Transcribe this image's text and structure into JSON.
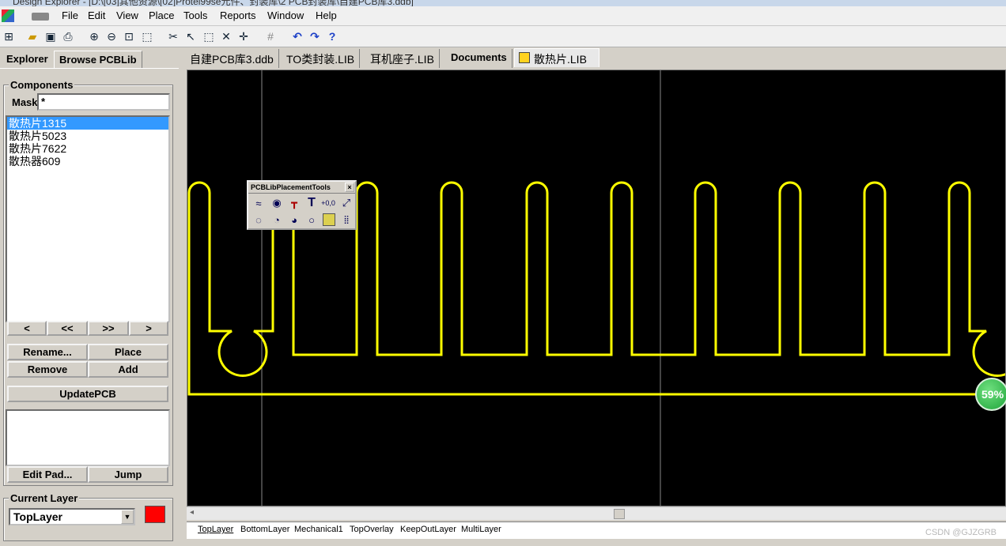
{
  "window": {
    "title": "Design Explorer - [D:\\[03]其他资源\\[02]Protel99se元件、封装库\\2 PCB封装库\\自建PCB库3.ddb]"
  },
  "menu": [
    "File",
    "Edit",
    "View",
    "Place",
    "Tools",
    "Reports",
    "Window",
    "Help"
  ],
  "left_tabs": {
    "explorer": "Explorer",
    "browse": "Browse PCBLib"
  },
  "components": {
    "title": "Components",
    "mask_label": "Mask",
    "mask_value": "*",
    "items": [
      "散热片1315",
      "散热片5023",
      "散热片7622",
      "散热器609"
    ],
    "nav": [
      "<",
      "<<",
      ">>",
      ">"
    ],
    "buttons": {
      "rename": "Rename...",
      "place": "Place",
      "remove": "Remove",
      "add": "Add",
      "update": "UpdatePCB",
      "edit_pad": "Edit Pad...",
      "jump": "Jump"
    }
  },
  "current_layer": {
    "title": "Current Layer",
    "value": "TopLayer",
    "color": "#ff0000"
  },
  "doc_tabs": [
    "自建PCB库3.ddb",
    "TO类封装.LIB",
    "耳机座子.LIB",
    "Documents",
    "散热片.LIB"
  ],
  "floating_toolbar": {
    "title": "PCBLibPlacementTools",
    "close": "×"
  },
  "layer_tabs": [
    "TopLayer",
    "BottomLayer",
    "Mechanical1",
    "TopOverlay",
    "KeepOutLayer",
    "MultiLayer"
  ],
  "zoom": "59%",
  "watermark": "CSDN @GJZGRB",
  "colors": {
    "canvas": "#000000",
    "trace": "#ffff00",
    "selection": "#3399ff"
  }
}
